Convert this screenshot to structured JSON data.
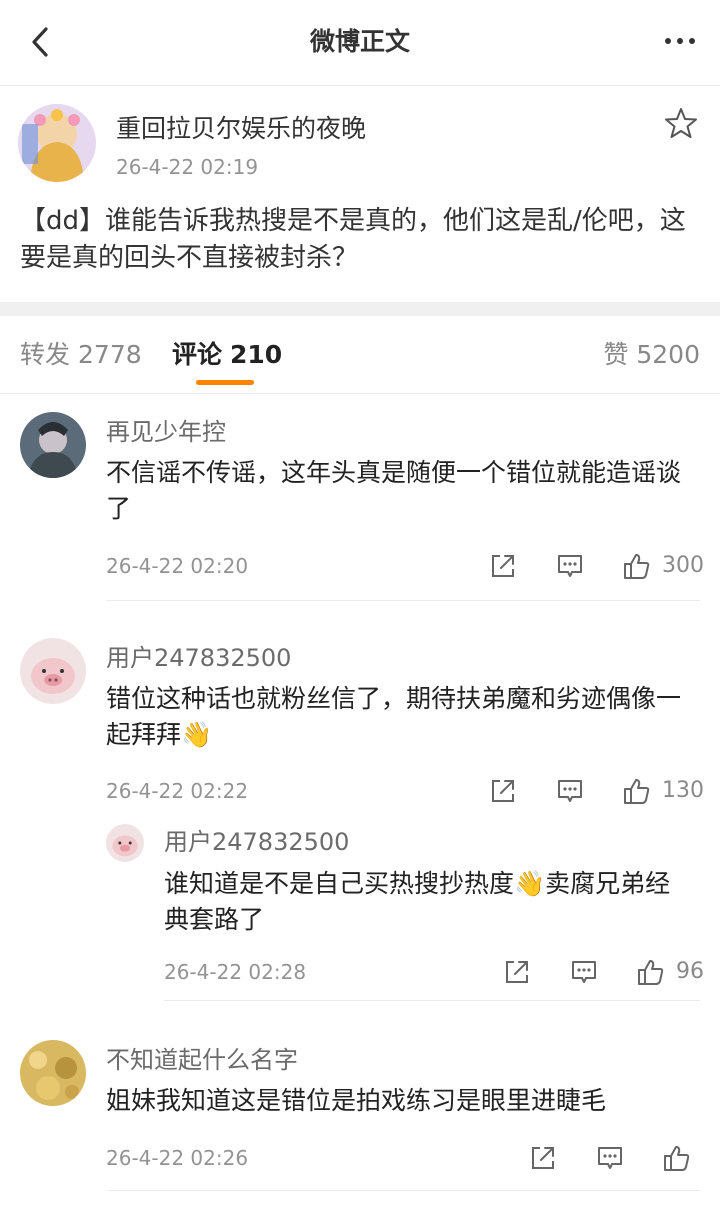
{
  "nav": {
    "title": "微博正文"
  },
  "post": {
    "author": "重回拉贝尔娱乐的夜晚",
    "time": "26-4-22 02:19",
    "content": "【dd】谁能告诉我热搜是不是真的，他们这是乱/伦吧，这要是真的回头不直接被封杀？"
  },
  "tabs": {
    "repost_label": "转发",
    "repost_count": "2778",
    "comment_label": "评论",
    "comment_count": "210",
    "like_label": "赞",
    "like_count": "5200"
  },
  "comments": [
    {
      "name": "再见少年控",
      "text": "不信谣不传谣，这年头真是随便一个错位就能造谣谈了",
      "time": "26-4-22 02:20",
      "likes": "300"
    },
    {
      "name": "用户247832500",
      "text_before": "错位这种话也就粉丝信了，期待扶弟魔和劣迹偶像一起拜拜",
      "emoji": "👋",
      "text_after": "",
      "time": "26-4-22 02:22",
      "likes": "130"
    },
    {
      "name": "用户247832500",
      "text_before": "谁知道是不是自己买热搜抄热度",
      "emoji": "👋",
      "text_after": "卖腐兄弟经典套路了",
      "time": "26-4-22 02:28",
      "likes": "96"
    },
    {
      "name": "不知道起什么名字",
      "text": "姐妹我知道这是错位是拍戏练习是眼里进睫毛",
      "time": "26-4-22 02:26",
      "likes": ""
    }
  ],
  "icons": {
    "back": "back-arrow-icon",
    "more": "more-dots-icon",
    "star": "star-icon",
    "share": "share-icon",
    "comment": "comment-icon",
    "like": "thumbs-up-icon"
  },
  "colors": {
    "accent": "#ff8200",
    "muted": "#939393",
    "text": "#222222"
  }
}
